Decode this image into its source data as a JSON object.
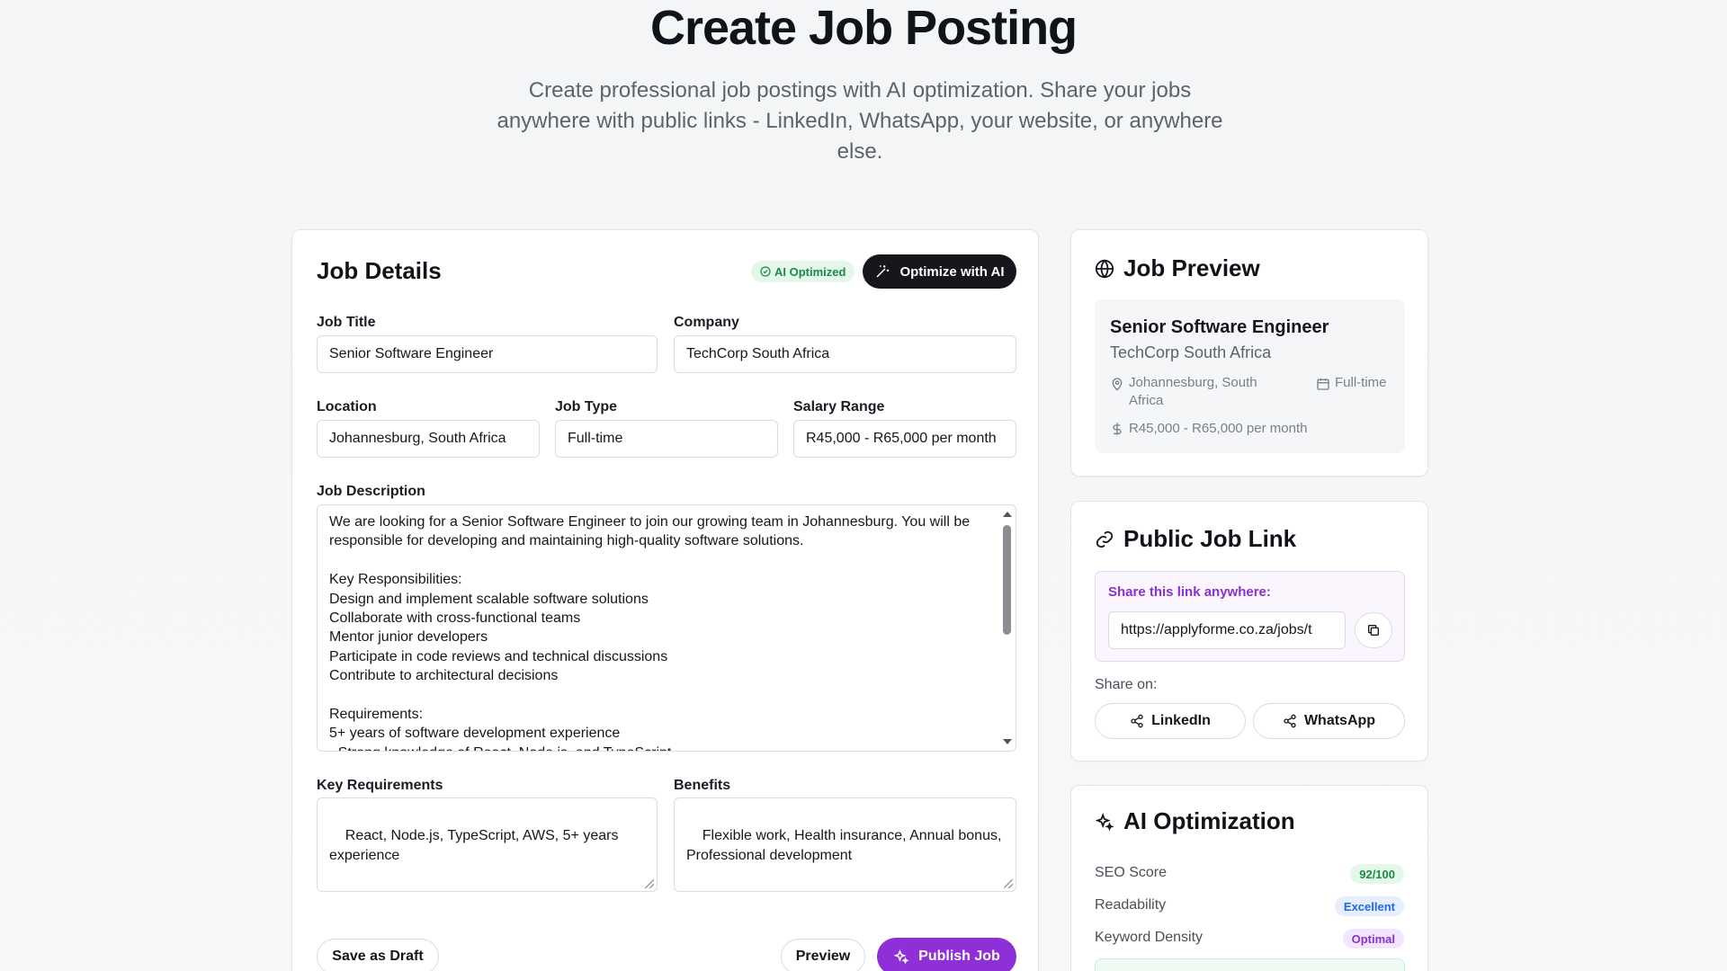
{
  "header": {
    "title": "Create Job Posting",
    "subtitle": "Create professional job postings with AI optimization. Share your jobs anywhere with public links - LinkedIn, WhatsApp, your website, or anywhere else."
  },
  "job_details": {
    "title": "Job Details",
    "ai_badge": "AI Optimized",
    "optimize_button": "Optimize with AI",
    "fields": {
      "job_title": {
        "label": "Job Title",
        "value": "Senior Software Engineer"
      },
      "company": {
        "label": "Company",
        "value": "TechCorp South Africa"
      },
      "location": {
        "label": "Location",
        "value": "Johannesburg, South Africa"
      },
      "job_type": {
        "label": "Job Type",
        "value": "Full-time"
      },
      "salary": {
        "label": "Salary Range",
        "value": "R45,000 - R65,000 per month"
      },
      "description": {
        "label": "Job Description",
        "value": "We are looking for a Senior Software Engineer to join our growing team in Johannesburg. You will be responsible for developing and maintaining high-quality software solutions.\n\nKey Responsibilities:\nDesign and implement scalable software solutions\nCollaborate with cross-functional teams\nMentor junior developers\nParticipate in code reviews and technical discussions\nContribute to architectural decisions\n\nRequirements:\n5+ years of software development experience\n- Strong knowledge of React, Node.js, and TypeScript"
      },
      "requirements": {
        "label": "Key Requirements",
        "value": "React, Node.js, TypeScript, AWS, 5+ years experience"
      },
      "benefits": {
        "label": "Benefits",
        "value": "Flexible work, Health insurance, Annual bonus, Professional development"
      }
    },
    "save_draft": "Save as Draft",
    "preview": "Preview",
    "publish": "Publish Job"
  },
  "preview": {
    "title": "Job Preview",
    "job_title": "Senior Software Engineer",
    "company": "TechCorp South Africa",
    "location": "Johannesburg, South Africa",
    "job_type": "Full-time",
    "salary": "R45,000 - R65,000 per month"
  },
  "public_link": {
    "title": "Public Job Link",
    "share_label": "Share this link anywhere:",
    "url": "https://applyforme.co.za/jobs/t",
    "share_on": "Share on:",
    "linkedin": "LinkedIn",
    "whatsapp": "WhatsApp"
  },
  "ai_optimization": {
    "title": "AI Optimization",
    "metrics": [
      {
        "label": "SEO Score",
        "value": "92/100",
        "color": "#1b8a45",
        "bg": "#e4f7ea"
      },
      {
        "label": "Readability",
        "value": "Excellent",
        "color": "#2563eb",
        "bg": "#e5efff"
      },
      {
        "label": "Keyword Density",
        "value": "Optimal",
        "color": "#8a2fd0",
        "bg": "#f3e6fc"
      }
    ]
  },
  "colors": {
    "accent": "#8f2fd8",
    "dark": "#15171c",
    "success": "#1b8a45"
  }
}
